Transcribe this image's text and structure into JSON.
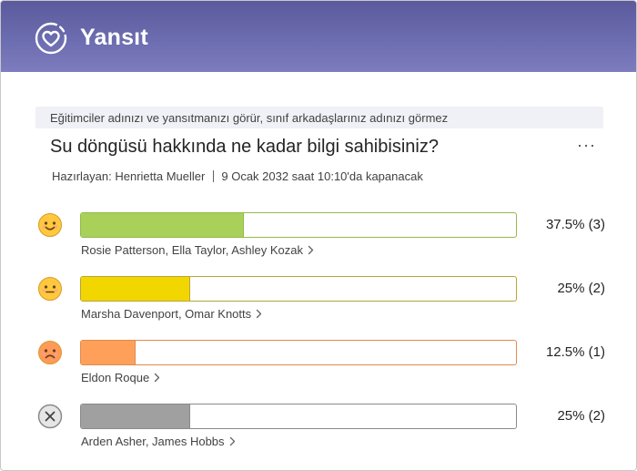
{
  "app": {
    "title": "Yansıt",
    "logo_icon": "heart-in-circle-icon"
  },
  "notice": "Eğitimciler adınızı ve yansıtmanızı görür, sınıf arkadaşlarınız adınızı görmez",
  "question": "Su döngüsü hakkında ne kadar bilgi sahibisiniz?",
  "menu_label": "···",
  "meta": {
    "author": "Hazırlayan: Henrietta Mueller",
    "deadline": "9 Ocak 2032 saat 10:10'da kapanacak"
  },
  "responses": [
    {
      "emoji": "happy-face-icon",
      "percent": 37.5,
      "label": "37.5% (3)",
      "names": "Rosie Patterson, Ella Taylor, Ashley Kozak",
      "color": "#a9d15a",
      "border": "#92ba4a"
    },
    {
      "emoji": "neutral-face-icon",
      "percent": 25,
      "label": "25% (2)",
      "names": "Marsha Davenport, Omar Knotts",
      "color": "#f2d600",
      "border": "#b9a43a"
    },
    {
      "emoji": "sad-face-icon",
      "percent": 12.5,
      "label": "12.5% (1)",
      "names": "Eldon Roque",
      "color": "#ffa05a",
      "border": "#e08a4e"
    },
    {
      "emoji": "no-response-icon",
      "percent": 25,
      "label": "25% (2)",
      "names": "Arden Asher, James Hobbs",
      "color": "#a0a0a0",
      "border": "#8a8a8a"
    }
  ]
}
